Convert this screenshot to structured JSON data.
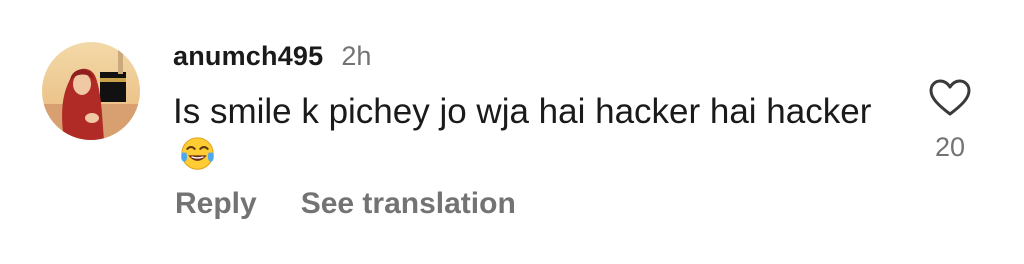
{
  "comment": {
    "username": "anumch495",
    "timestamp": "2h",
    "text": "Is smile k pichey jo wja hai hacker hai hacker",
    "emoji": "face-with-tears-of-joy-icon",
    "like_count": "20"
  },
  "actions": {
    "reply_label": "Reply",
    "translate_label": "See translation"
  },
  "icons": {
    "like": "heart-outline-icon"
  },
  "colors": {
    "primary_text": "#1a1a1a",
    "secondary_text": "#737373",
    "emoji_yellow": "#FFCC33",
    "tears_blue": "#4EA8F0"
  }
}
